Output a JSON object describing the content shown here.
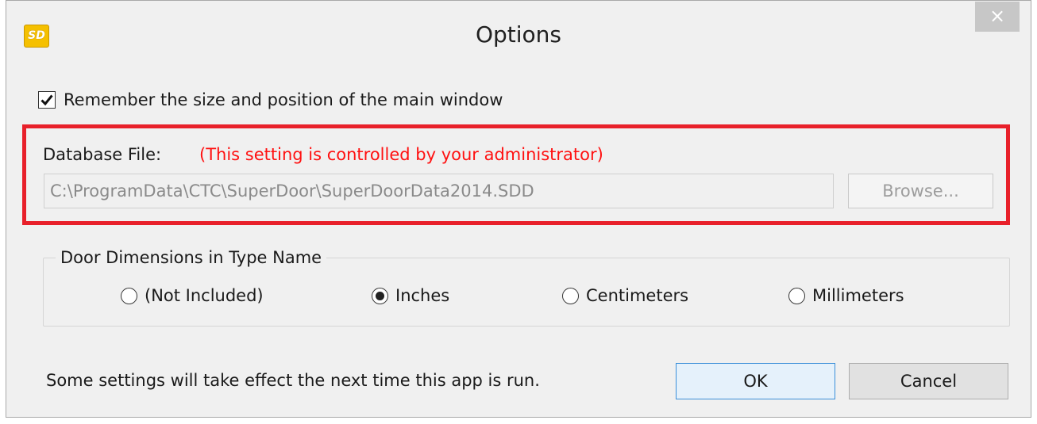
{
  "window": {
    "title": "Options",
    "app_icon_text": "SD",
    "close_glyph": "×"
  },
  "remember_window": {
    "label": "Remember the size and position of the main window",
    "checked": true
  },
  "database": {
    "label": "Database File:",
    "admin_note": "(This setting is controlled by your administrator)",
    "path": "C:\\ProgramData\\CTC\\SuperDoor\\SuperDoorData2014.SDD",
    "browse_label": "Browse...",
    "enabled": false
  },
  "dimensions_group": {
    "legend": "Door Dimensions in Type Name",
    "options": [
      {
        "label": "(Not Included)",
        "selected": false
      },
      {
        "label": "Inches",
        "selected": true
      },
      {
        "label": "Centimeters",
        "selected": false
      },
      {
        "label": "Millimeters",
        "selected": false
      }
    ]
  },
  "footer": {
    "note": "Some settings will take effect the next time this app is run.",
    "ok_label": "OK",
    "cancel_label": "Cancel"
  },
  "colors": {
    "highlight_border": "#e8202a",
    "admin_note_text": "#ff1010",
    "ok_button_border": "#3c8fd9",
    "app_icon_bg": "#f5c000"
  },
  "icons": {
    "app": "app-logo-icon",
    "close": "close-icon",
    "check": "checkmark-icon"
  }
}
